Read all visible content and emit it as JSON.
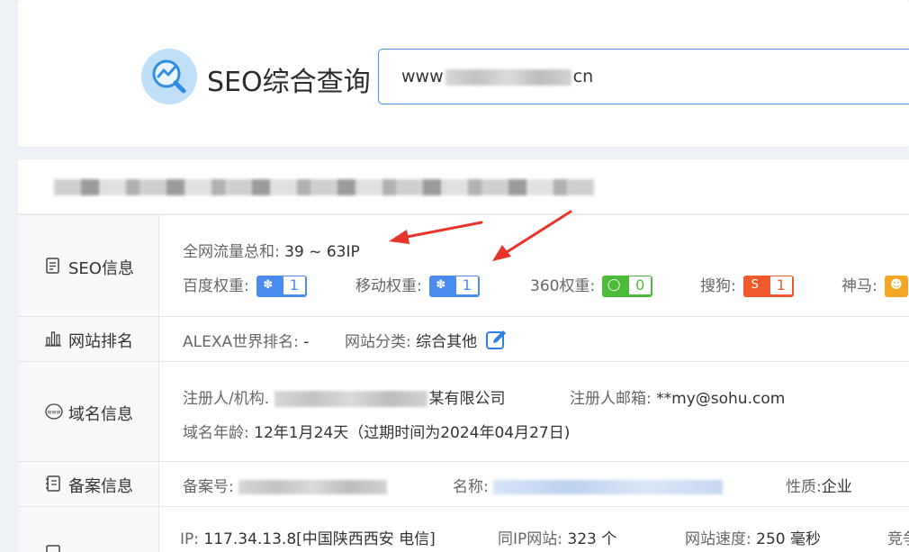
{
  "header": {
    "brand": "SEO综合查询",
    "search_prefix": "www",
    "search_suffix": "cn"
  },
  "rows": {
    "seo": {
      "label": "SEO信息",
      "traffic_label": "全网流量总和:",
      "traffic_value": "39 ~ 63IP",
      "baidu_label": "百度权重:",
      "baidu_value": "1",
      "mobile_label": "移动权重:",
      "mobile_value": "1",
      "s360_label": "360权重:",
      "s360_value": "0",
      "sogou_label": "搜狗:",
      "sogou_value": "1",
      "shenma_label": "神马:"
    },
    "rank": {
      "label": "网站排名",
      "alexa_label": "ALEXA世界排名:",
      "alexa_value": "-",
      "category_label": "网站分类:",
      "category_value": "综合其他"
    },
    "domain": {
      "label": "域名信息",
      "registrant_label": "注册人/机构.",
      "registrant_value": "某有限公司",
      "email_label": "注册人邮箱:",
      "email_value": "**my@sohu.com",
      "age_label": "域名年龄:",
      "age_value": "12年1月24天（过期时间为2024年04月27日)"
    },
    "icp": {
      "label": "备案信息",
      "number_label": "备案号:",
      "name_label": "名称:",
      "nature_label": "性质:",
      "nature_value": "企业"
    },
    "ip": {
      "ip_label": "IP:",
      "ip_value": "117.34.13.8[中国陕西西安 电信]",
      "same_ip_label": "同IP网站:",
      "same_ip_value": "323 个",
      "speed_label": "网站速度:",
      "speed_value": "250 毫秒",
      "more_label": "竞争"
    }
  },
  "colors": {
    "baidu": "#4a8cf0",
    "s360": "#4cbb3a",
    "sogou": "#f05a2c",
    "shenma": "#f5a623",
    "arrow": "#e8332a",
    "search_border": "#4c8ff3"
  }
}
